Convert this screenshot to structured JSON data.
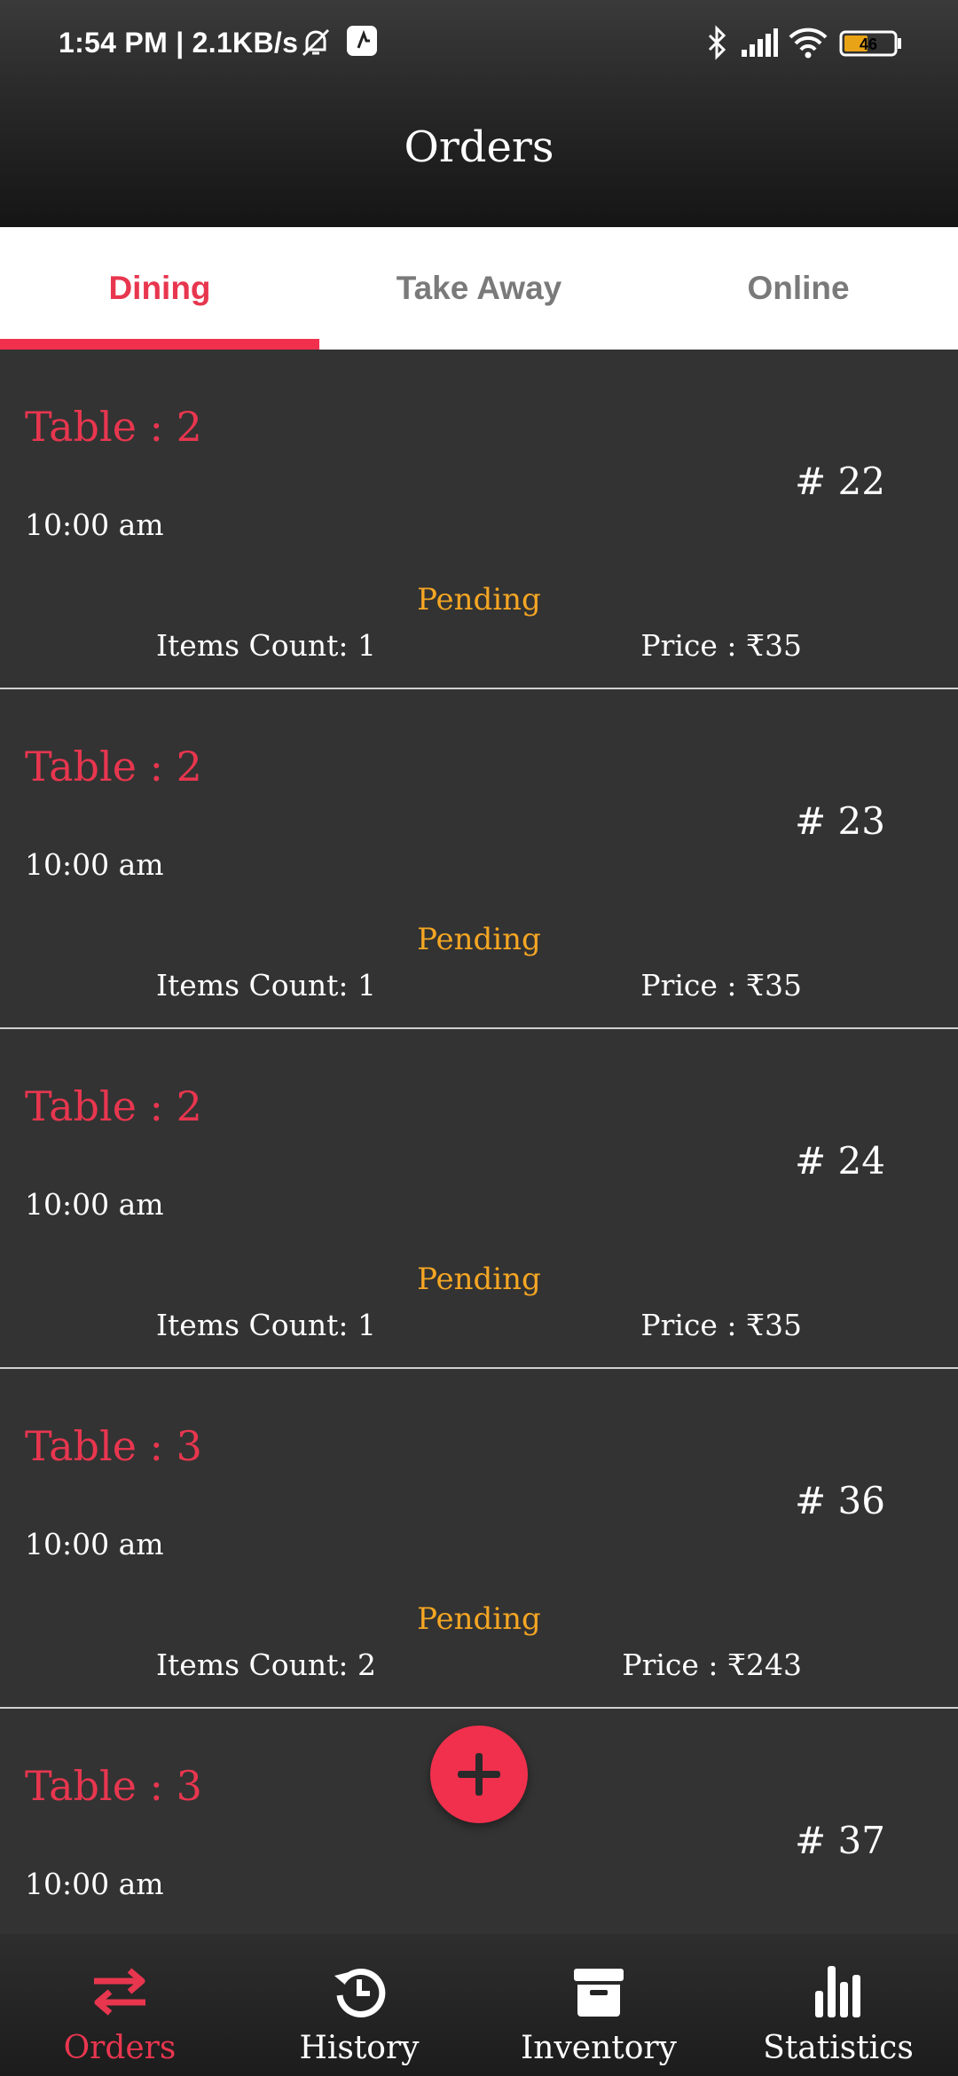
{
  "status_bar": {
    "time_text": "1:54 PM | 2.1KB/s",
    "battery_level": "46"
  },
  "app_bar": {
    "title": "Orders"
  },
  "tabs": [
    {
      "label": "Dining",
      "active": true
    },
    {
      "label": "Take Away",
      "active": false
    },
    {
      "label": "Online",
      "active": false
    }
  ],
  "orders": [
    {
      "table": "Table : 2",
      "number": "# 22",
      "time": "10:00 am",
      "status": "Pending",
      "items": "Items Count: 1",
      "price": "Price : ₹35"
    },
    {
      "table": "Table : 2",
      "number": "# 23",
      "time": "10:00 am",
      "status": "Pending",
      "items": "Items Count: 1",
      "price": "Price : ₹35"
    },
    {
      "table": "Table : 2",
      "number": "# 24",
      "time": "10:00 am",
      "status": "Pending",
      "items": "Items Count: 1",
      "price": "Price : ₹35"
    },
    {
      "table": "Table : 3",
      "number": "# 36",
      "time": "10:00 am",
      "status": "Pending",
      "items": "Items Count: 2",
      "price": "Price : ₹243"
    },
    {
      "table": "Table : 3",
      "number": "# 37",
      "time": "10:00 am",
      "status": "",
      "items": "",
      "price": ""
    }
  ],
  "fab": {
    "icon": "plus-icon"
  },
  "bottom_nav": [
    {
      "label": "Orders",
      "icon": "swap-arrows-icon",
      "active": true
    },
    {
      "label": "History",
      "icon": "history-icon",
      "active": false
    },
    {
      "label": "Inventory",
      "icon": "archive-box-icon",
      "active": false
    },
    {
      "label": "Statistics",
      "icon": "bar-chart-icon",
      "active": false
    }
  ],
  "colors": {
    "accent": "#f0304d",
    "pending": "#f5a623",
    "background": "#333333"
  }
}
